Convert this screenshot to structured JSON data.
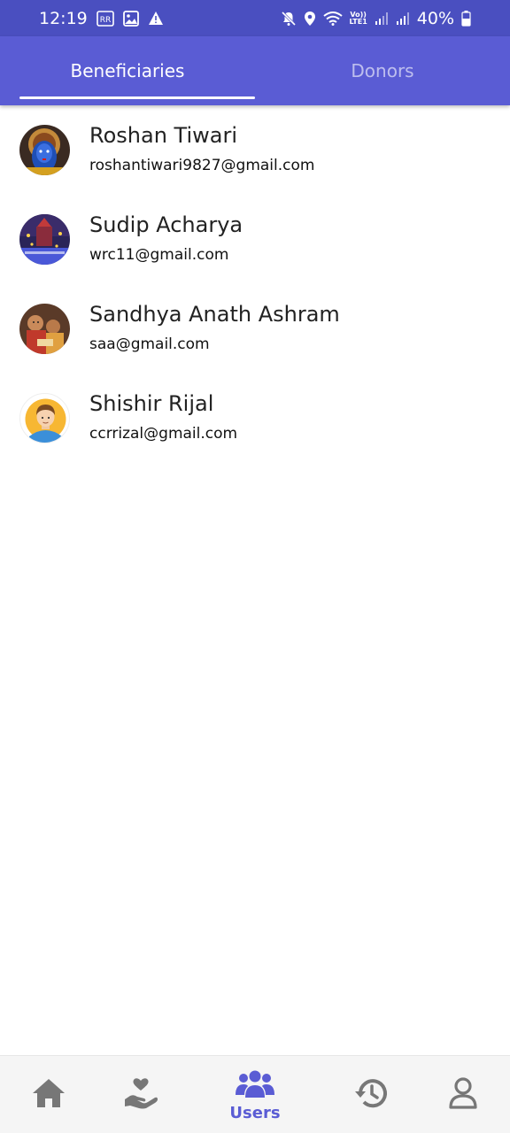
{
  "status_bar": {
    "time": "12:19",
    "lte_label": "LTE1",
    "volte_label": "Vo))",
    "battery": "40%"
  },
  "tabs": [
    {
      "label": "Beneficiaries",
      "active": true
    },
    {
      "label": "Donors",
      "active": false
    }
  ],
  "users": [
    {
      "name": "Roshan Tiwari",
      "email": "roshantiwari9827@gmail.com",
      "avatar": "photo-blue-deity"
    },
    {
      "name": "Sudip Acharya",
      "email": "wrc11@gmail.com",
      "avatar": "photo-night-lights"
    },
    {
      "name": "Sandhya Anath Ashram",
      "email": "saa@gmail.com",
      "avatar": "photo-children"
    },
    {
      "name": "Shishir Rijal",
      "email": "ccrrizal@gmail.com",
      "avatar": "default-user-avatar"
    }
  ],
  "bottom_nav": {
    "items": [
      {
        "icon": "home-icon"
      },
      {
        "icon": "donate-hand-heart-icon"
      },
      {
        "icon": "users-group-icon",
        "label": "Users",
        "active": true
      },
      {
        "icon": "history-icon"
      },
      {
        "icon": "profile-icon"
      }
    ]
  },
  "colors": {
    "status_bar": "#4a4fc0",
    "primary": "#5a5cd4",
    "nav_inactive": "#777777"
  }
}
